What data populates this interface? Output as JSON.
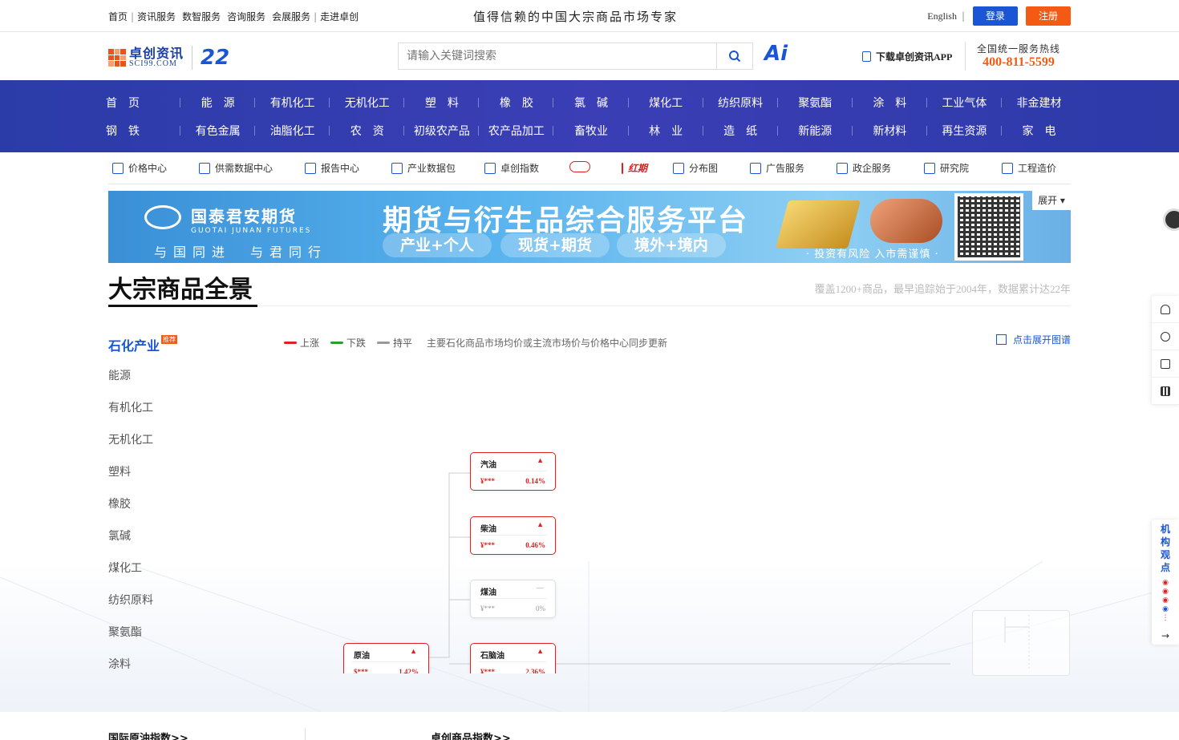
{
  "topbar": {
    "links": [
      "首页",
      "资讯服务",
      "数智服务",
      "咨询服务",
      "会展服务",
      "走进卓创"
    ],
    "slogan": "值得信赖的中国大宗商品市场专家",
    "english": "English",
    "login": "登录",
    "register": "注册"
  },
  "header": {
    "logo_name": "卓创资讯",
    "logo_domain": "SCI99.COM",
    "anniversary": "22",
    "search_placeholder": "请输入关键词搜索",
    "ai_label": "Ai",
    "app_download": "下载卓创资讯APP",
    "hotline_title": "全国统一服务热线",
    "hotline_number": "400-811-5599"
  },
  "mainnav": {
    "row1": [
      "首　页",
      "能　源",
      "有机化工",
      "无机化工",
      "塑　料",
      "橡　胶",
      "氯　碱",
      "煤化工",
      "纺织原料",
      "聚氨酯",
      "涂　料",
      "工业气体",
      "非金建材"
    ],
    "row2": [
      "钢　铁",
      "有色金属",
      "油脂化工",
      "农　资",
      "初级农产品",
      "农产品加工",
      "畜牧业",
      "林　业",
      "造　纸",
      "新能源",
      "新材料",
      "再生资源",
      "家　电"
    ]
  },
  "subnav": [
    {
      "label": "价格中心",
      "icon": "bar-chart-icon"
    },
    {
      "label": "供需数据中心",
      "icon": "cycle-icon"
    },
    {
      "label": "报告中心",
      "icon": "report-icon"
    },
    {
      "label": "产业数据包",
      "icon": "package-icon"
    },
    {
      "label": "卓创指数",
      "icon": "index-icon"
    },
    {
      "label": "",
      "icon": "brand-logo-icon"
    },
    {
      "label": "红期",
      "icon": "hongqi-logo-icon"
    },
    {
      "label": "分布图",
      "icon": "map-icon"
    },
    {
      "label": "广告服务",
      "icon": "ad-icon"
    },
    {
      "label": "政企服务",
      "icon": "government-icon"
    },
    {
      "label": "研究院",
      "icon": "institute-icon"
    },
    {
      "label": "工程造价",
      "icon": "engineering-icon"
    }
  ],
  "banner": {
    "company_cn": "国泰君安期货",
    "company_en": "GUOTAI JUNAN FUTURES",
    "motto": "与国同进　与君同行",
    "headline": "期货与衍生品综合服务平台",
    "pills": [
      "产业+个人",
      "现货+期货",
      "境外+境内"
    ],
    "risk": "· 投资有风险  入市需谨慎 ·",
    "expand": "展开"
  },
  "section": {
    "title": "大宗商品全景",
    "description": "覆盖1200+商品，最早追踪始于2004年，数据累计达22年"
  },
  "leftmenu": {
    "active": "石化产业",
    "active_tag": "推荐",
    "items": [
      "能源",
      "有机化工",
      "无机化工",
      "塑料",
      "橡胶",
      "氯碱",
      "煤化工",
      "纺织原料",
      "聚氨酯",
      "涂料"
    ]
  },
  "legend": {
    "up": "上涨",
    "down": "下跌",
    "flat": "持平",
    "up_color": "#e02020",
    "down_color": "#2aa02a",
    "flat_color": "#999999",
    "note": "主要石化商品市场均价或主流市场价与价格中心同步更新"
  },
  "expand_label": "点击展开图谱",
  "tree_cards": [
    {
      "name": "汽油",
      "price": "¥***",
      "pct": "0.14%",
      "trend": "up",
      "arrow": "▲"
    },
    {
      "name": "柴油",
      "price": "¥***",
      "pct": "0.46%",
      "trend": "up",
      "arrow": "▲"
    },
    {
      "name": "煤油",
      "price": "¥***",
      "pct": "0%",
      "trend": "flat",
      "arrow": "—"
    },
    {
      "name": "原油",
      "price": "$***",
      "pct": "1.42%",
      "trend": "up",
      "arrow": "▲"
    },
    {
      "name": "石脑油",
      "price": "¥***",
      "pct": "2.36%",
      "trend": "up",
      "arrow": "▲"
    }
  ],
  "sidebar": {
    "icons": [
      "headset-icon",
      "contact-icon",
      "feedback-icon",
      "qrcode-icon"
    ],
    "institution_label": "机构观点"
  },
  "bottom": {
    "left": "国际原油指数>>",
    "right": "卓创商品指数>>"
  }
}
